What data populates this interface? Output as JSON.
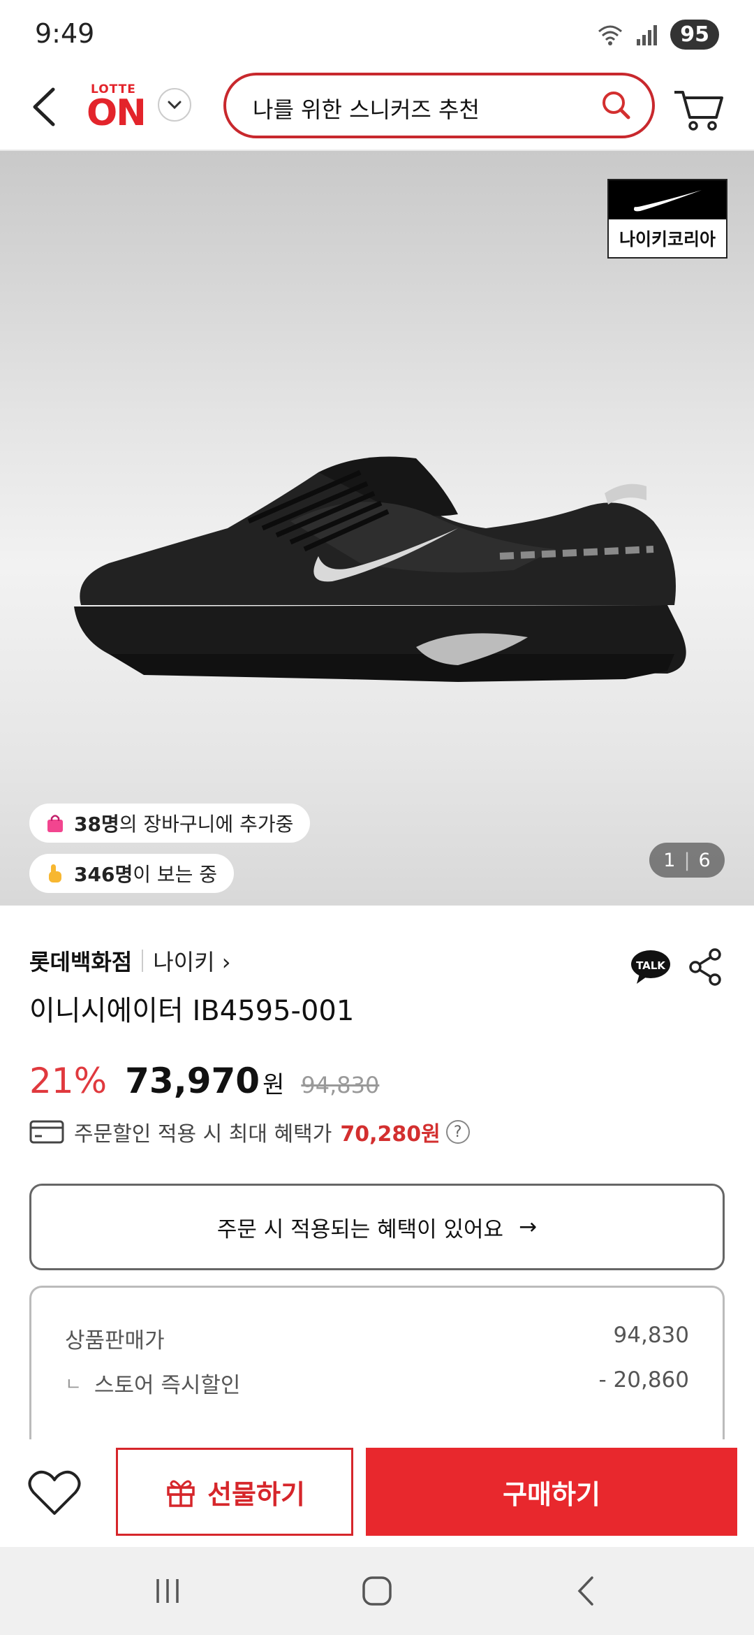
{
  "status_bar": {
    "time": "9:49",
    "battery": "95"
  },
  "header": {
    "logo_top": "LOTTE",
    "logo_bottom": "ON",
    "search_text": "나를 위한 스니커즈 추천"
  },
  "gallery": {
    "brand_badge": "나이키코리아",
    "cart_count": "38명",
    "cart_suffix": "의 장바구니에 추가중",
    "view_count": "346명",
    "view_suffix": "이 보는 중",
    "page_current": "1",
    "page_total": "6"
  },
  "product": {
    "store": "롯데백화점",
    "brand": "나이키",
    "brand_chevron": "›",
    "talk_label": "TALK",
    "name": "이니시에이터  IB4595-001",
    "discount": "21%",
    "price": "73,970",
    "currency": "원",
    "original_price": "94,830",
    "benefit_label": "주문할인 적용 시 최대 혜택가",
    "benefit_price": "70,280원",
    "help": "?",
    "coupon_label": "주문 시 적용되는 혜택이 있어요",
    "coupon_arrow": "→"
  },
  "price_detail": {
    "rows": [
      {
        "label": "상품판매가",
        "value": "94,830"
      },
      {
        "label": "스토어 즉시할인",
        "mark": "ㄴ",
        "value": "- 20,860"
      }
    ]
  },
  "bottom_bar": {
    "gift_label": "선물하기",
    "buy_label": "구매하기"
  },
  "colors": {
    "brand_red": "#e3242b",
    "buy_red": "#e8282d",
    "discount_red": "#e0393e"
  }
}
